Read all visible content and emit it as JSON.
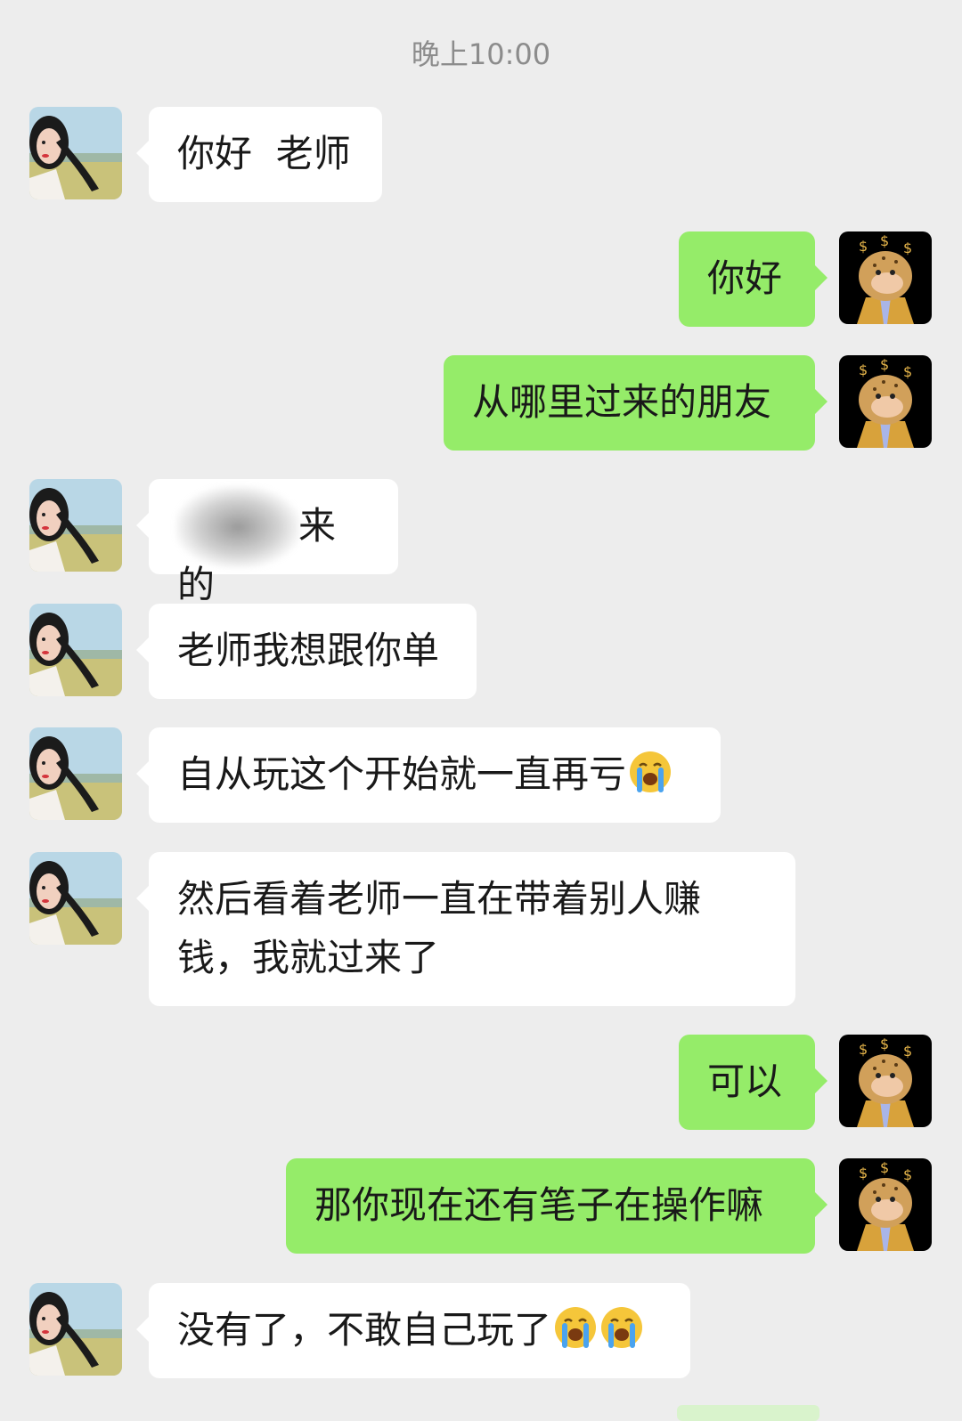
{
  "timestamp": "晚上10:00",
  "contacts": {
    "student_avatar_icon": "girl-portrait-icon",
    "teacher_avatar_icon": "monkey-dollar-avatar-icon"
  },
  "colors": {
    "background": "#ededed",
    "incoming_bubble": "#ffffff",
    "outgoing_bubble": "#95ec69"
  },
  "messages": [
    {
      "side": "in",
      "text": "你好  老师"
    },
    {
      "side": "out",
      "text": "你好"
    },
    {
      "side": "out",
      "text": "从哪里过来的朋友"
    },
    {
      "side": "in",
      "text": "来的",
      "redacted_prefix": true
    },
    {
      "side": "in",
      "text": "老师我想跟你单"
    },
    {
      "side": "in",
      "text": "自从玩这个开始就一直再亏",
      "emoji_count": 1
    },
    {
      "side": "in",
      "text_line1": "然后看着老师一直在带着别人赚",
      "text_line2": "钱，我就过来了"
    },
    {
      "side": "out",
      "text": "可以"
    },
    {
      "side": "out",
      "text": "那你现在还有笔子在操作嘛"
    },
    {
      "side": "in",
      "text": "没有了，不敢自己玩了",
      "emoji_count": 2
    }
  ],
  "emoji_name": "loudly-crying-face-icon"
}
